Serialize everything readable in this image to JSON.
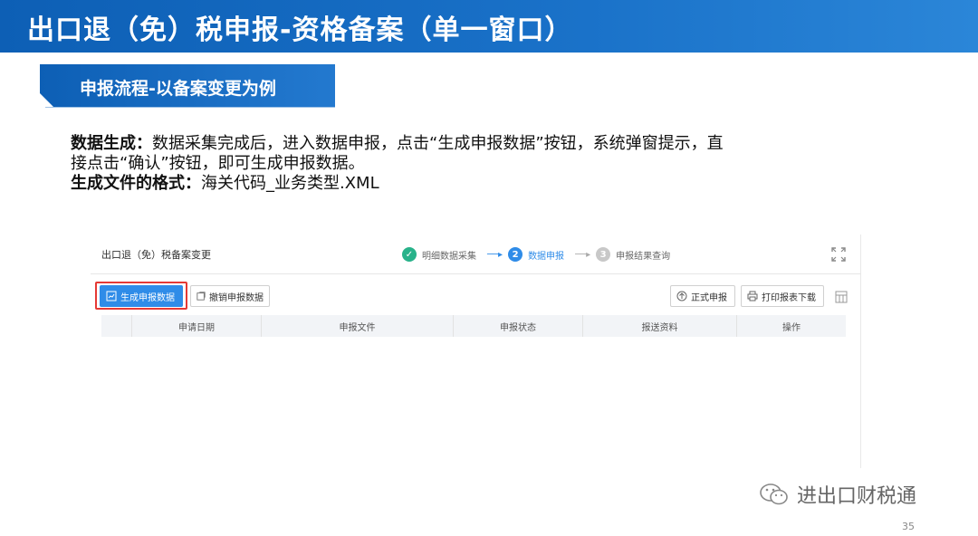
{
  "slide": {
    "title": "出口退（免）税申报-资格备案（单一窗口）",
    "section_tag": "申报流程-以备案变更为例",
    "body": {
      "line1_bold": "数据生成：",
      "line1_text": "数据采集完成后，进入数据申报，点击“生成申报数据”按钮，系统弹窗提示，直",
      "line2_text": "接点击“确认”按钮，即可生成申报数据。",
      "line3_bold": "生成文件的格式：",
      "line3_text": "海关代码_业务类型.XML"
    },
    "watermark": "进出口财税通",
    "page_number": "35"
  },
  "panel": {
    "title": "出口退（免）税备案变更",
    "steps": [
      {
        "num": "✓",
        "label": "明细数据采集",
        "state": "done"
      },
      {
        "num": "2",
        "label": "数据申报",
        "state": "active"
      },
      {
        "num": "3",
        "label": "申报结果查询",
        "state": "todo"
      }
    ],
    "toolbar": {
      "generate_label": "生成申报数据",
      "revoke_label": "撤销申报数据",
      "submit_label": "正式申报",
      "print_label": "打印报表下载"
    },
    "table": {
      "columns": [
        "",
        "申请日期",
        "申报文件",
        "申报状态",
        "报送资料",
        "操作"
      ]
    }
  },
  "colors": {
    "title_bar": "#0d5fb5",
    "accent": "#2f8ce8",
    "highlight": "#e53935",
    "step_done": "#28b28a"
  }
}
